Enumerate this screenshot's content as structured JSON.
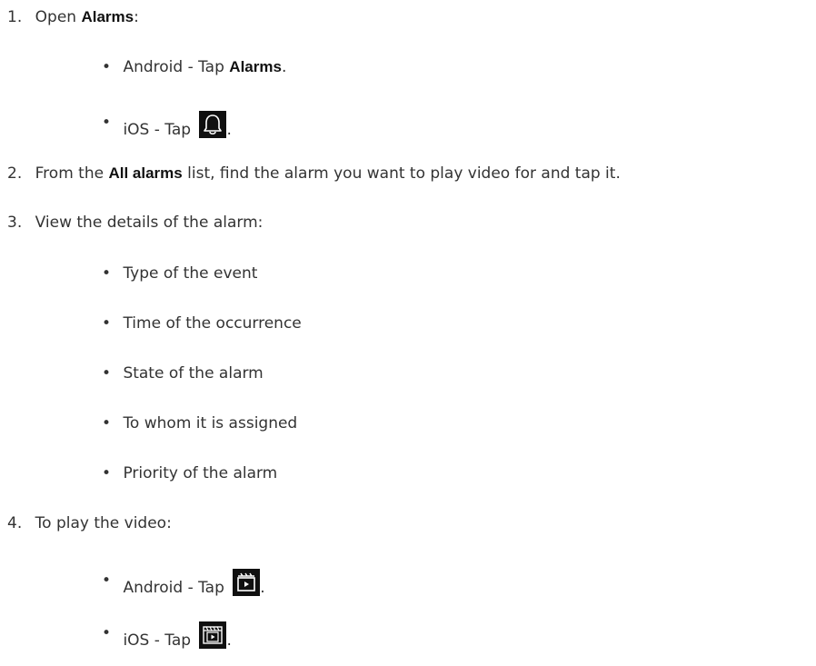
{
  "steps": [
    {
      "number": "1.",
      "text_before": "Open ",
      "bold": "Alarms",
      "text_after": ":",
      "sub": [
        {
          "before": "Android - Tap ",
          "bold": "Alarms",
          "after": "."
        },
        {
          "before": "iOS - Tap ",
          "icon": "bell-icon",
          "after": "."
        }
      ]
    },
    {
      "number": "2.",
      "text_before": "From the ",
      "bold": "All alarms",
      "text_after": " list, find the alarm you want to play video for and tap it."
    },
    {
      "number": "3.",
      "text": "View the details of the alarm:",
      "sub": [
        {
          "text": "Type of the event"
        },
        {
          "text": "Time of the occurrence"
        },
        {
          "text": "State of the alarm"
        },
        {
          "text": "To whom it is assigned"
        },
        {
          "text": "Priority of the alarm"
        }
      ]
    },
    {
      "number": "4.",
      "text": "To play the video:",
      "sub": [
        {
          "before": "Android - Tap ",
          "icon": "video-clip-icon",
          "after": "."
        },
        {
          "before": "iOS - Tap ",
          "icon": "video-playback-icon",
          "after": "."
        }
      ]
    }
  ],
  "colors": {
    "text": "#333333",
    "icon_bg": "#101010",
    "icon_fg": "#ffffff"
  }
}
